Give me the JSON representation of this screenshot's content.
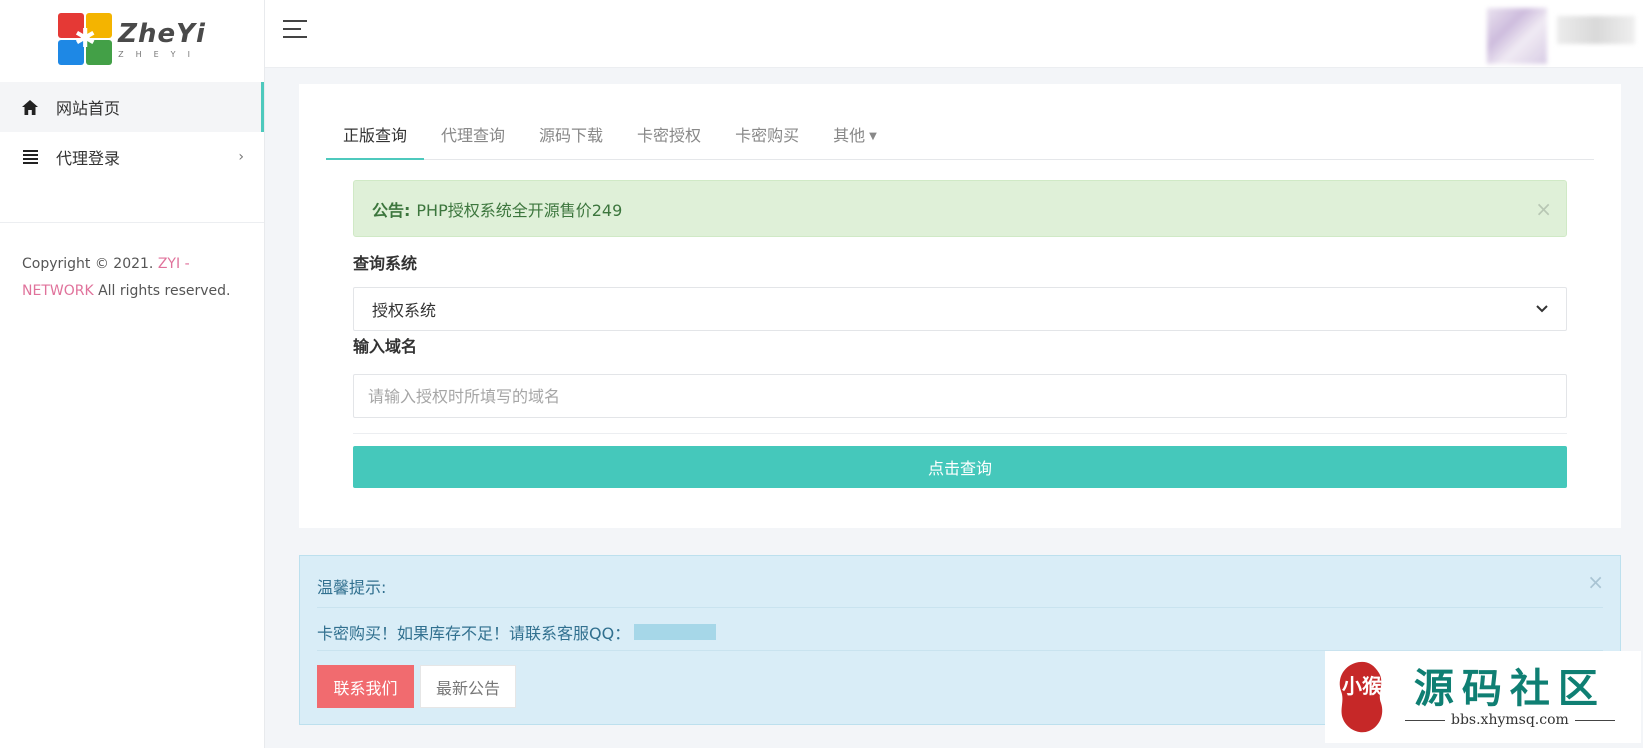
{
  "logo": {
    "title": "ZheYi",
    "subtitle": "ZHEYI"
  },
  "sidebar": {
    "items": [
      {
        "label": "网站首页",
        "icon": "home-icon"
      },
      {
        "label": "代理登录",
        "icon": "list-icon"
      }
    ],
    "copyright": {
      "prefix": "Copyright © 2021.",
      "brand": "ZYI - NETWORK",
      "suffix": "All rights reserved."
    }
  },
  "tabs": [
    "正版查询",
    "代理查询",
    "源码下载",
    "卡密授权",
    "卡密购买",
    "其他"
  ],
  "notice": {
    "label": "公告:",
    "text": "PHP授权系统全开源售价249"
  },
  "form": {
    "system_label": "查询系统",
    "system_value": "授权系统",
    "domain_label": "输入域名",
    "domain_placeholder": "请输入授权时所填写的域名",
    "submit_label": "点击查询"
  },
  "info": {
    "title": "温馨提示:",
    "text": "卡密购买！如果库存不足！请联系客服QQ：",
    "contact_button": "联系我们",
    "news_button": "最新公告"
  },
  "watermark": {
    "title": "源码社区",
    "url": "bbs.xhymsq.com",
    "seal_text": "小猴"
  },
  "colors": {
    "accent": "#45c8bb",
    "danger": "#f16b6f",
    "brand_pink": "#e0729b",
    "success_bg": "#dff0d8",
    "info_bg": "#d9edf7"
  }
}
